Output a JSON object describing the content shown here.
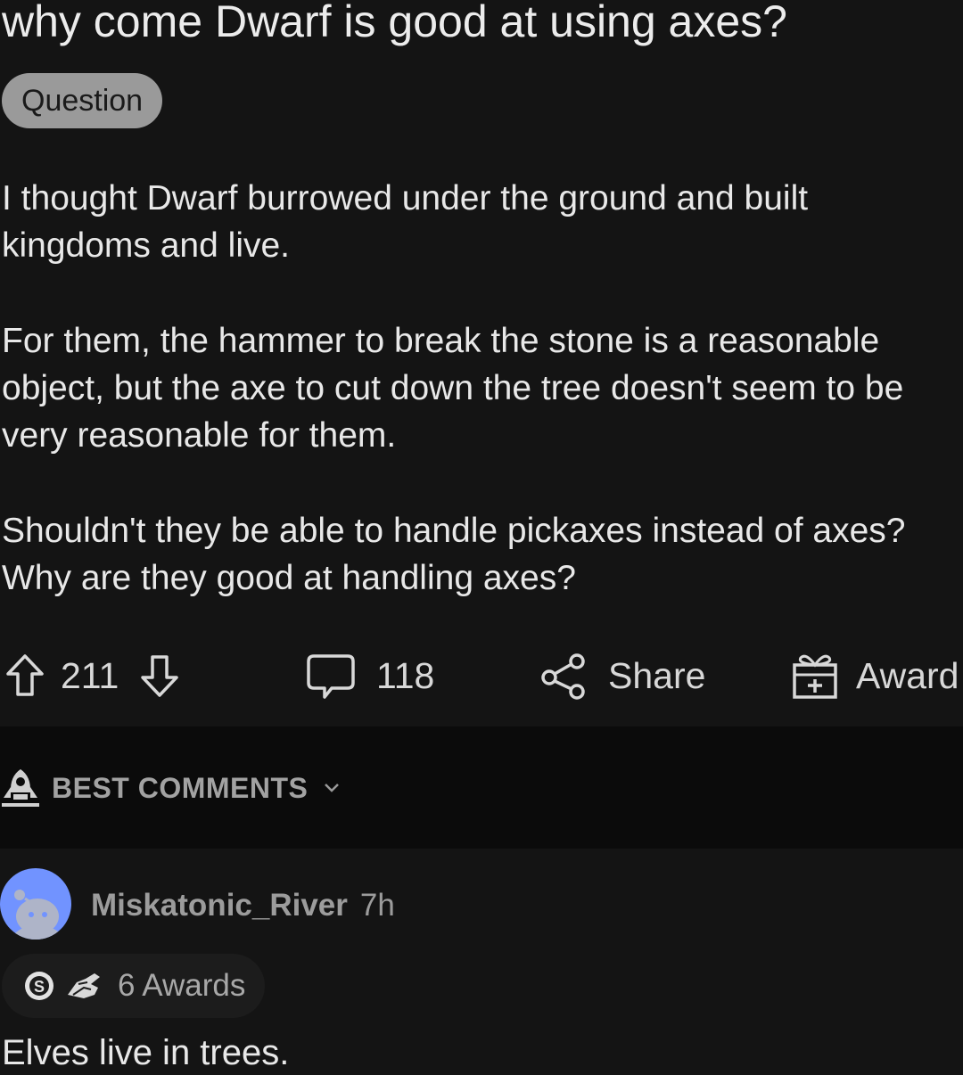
{
  "post": {
    "title": "why come Dwarf is good at using axes?",
    "flair": "Question",
    "body": [
      "I thought Dwarf burrowed under the ground and built kingdoms and live.",
      "For them, the hammer to break the stone is a reasonable object, but the axe to cut down the tree doesn't seem to be very reasonable for them.",
      "Shouldn't they be able to handle pickaxes instead of axes? Why are they good at handling axes?"
    ]
  },
  "actions": {
    "upvote_icon": "arrow-up-outline-icon",
    "vote_count": "211",
    "downvote_icon": "arrow-down-outline-icon",
    "comment_icon": "speech-bubble-icon",
    "comment_count": "118",
    "share_icon": "share-nodes-icon",
    "share_label": "Share",
    "award_icon": "gift-icon",
    "award_label": "Award"
  },
  "comments_sort": {
    "icon": "rocket-icon",
    "label": "BEST COMMENTS",
    "chevron_icon": "chevron-down-icon"
  },
  "comment": {
    "avatar_icon": "snoo-avatar-icon",
    "username": "Miskatonic_River",
    "time": "7h",
    "award_icons": [
      "silver-coin-award-icon",
      "helping-hand-award-icon"
    ],
    "awards_label": "6 Awards",
    "text": "Elves live in trees."
  },
  "colors": {
    "background": "#141414",
    "sort_bar_background": "#0b0b0b",
    "flair_background": "#9a9a9a",
    "avatar_blue": "#7193ff",
    "primary_text": "#e8e8e8",
    "secondary_text": "#9c9c9c"
  }
}
